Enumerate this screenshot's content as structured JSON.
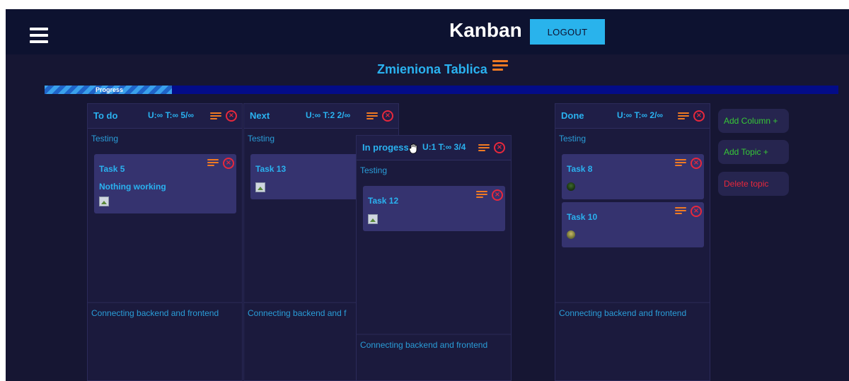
{
  "header": {
    "title": "Kanban",
    "logout_label": "LOGOUT"
  },
  "board": {
    "title": "Zmieniona Tablica",
    "progress_label": "Progress",
    "progress_fraction": 0.16
  },
  "columns": [
    {
      "name": "To do",
      "stats": "U:∞ T:∞ 5/∞",
      "lanes": [
        {
          "label": "Testing",
          "cards": [
            {
              "title": "Task 5",
              "description": "Nothing working",
              "image": "broken-image"
            }
          ]
        },
        {
          "label": "Connecting backend and frontend",
          "cards": []
        }
      ]
    },
    {
      "name": "Next",
      "stats": "U:∞ T:2 2/∞",
      "lanes": [
        {
          "label": "Testing",
          "cards": [
            {
              "title": "Task 13",
              "image": "broken-image"
            }
          ]
        },
        {
          "label": "Connecting backend and f",
          "cards": []
        }
      ]
    },
    {
      "name": "In progess",
      "stats": "U:1 T:∞ 3/4",
      "state": "being-dragged",
      "lanes": [
        {
          "label": "Testing",
          "cards": [
            {
              "title": "Task 12",
              "image": "broken-image"
            }
          ]
        },
        {
          "label": "Connecting backend and frontend",
          "cards": []
        }
      ]
    },
    {
      "name": "Done",
      "stats": "U:∞ T:∞ 2/∞",
      "lanes": [
        {
          "label": "Testing",
          "cards": [
            {
              "title": "Task 8",
              "image": "avatar-dark-green"
            },
            {
              "title": "Task 10",
              "image": "avatar-olive"
            }
          ]
        },
        {
          "label": "Connecting backend and frontend",
          "cards": []
        }
      ]
    }
  ],
  "actions": {
    "add_column": "Add Column +",
    "add_topic": "Add Topic +",
    "delete_topic": "Delete topic"
  },
  "icons": {
    "menu": "hamburger-menu-icon",
    "options": "lines-menu-icon",
    "remove": "circle-x-icon",
    "cursor": "hand-grab-cursor"
  },
  "colors": {
    "page_background": "#161633",
    "topbar_background": "#0d1230",
    "accent_blue": "#2ab2f0",
    "logout_button": "#29b3ec",
    "menu_orange": "#f07a23",
    "close_red": "#e8283c",
    "add_green": "#37c837",
    "delete_red": "#e8283c",
    "card_background": "#35336f",
    "progress_track": "#030c88"
  }
}
